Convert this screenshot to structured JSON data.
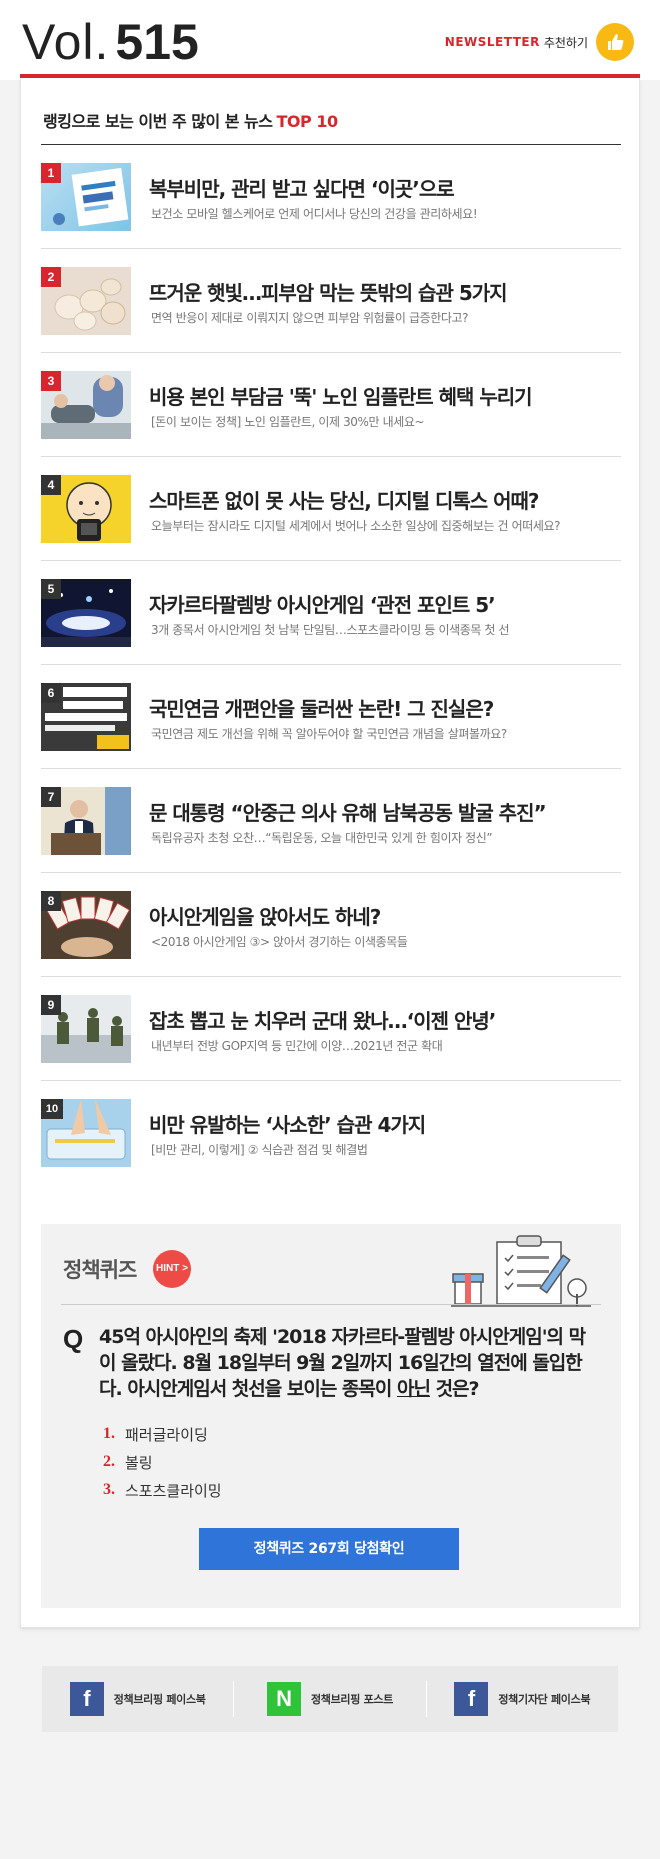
{
  "header": {
    "vol_prefix": "Vol.",
    "vol_number": "515",
    "newsletter_label": "NEWSLETTER",
    "recommend_label": "추천하기"
  },
  "ranking": {
    "title_prefix": "랭킹으로 보는 이번 주 많이 본 뉴스",
    "title_highlight": "TOP 10",
    "items": [
      {
        "rank": "1",
        "title": "복부비만, 관리 받고 싶다면 ‘이곳’으로",
        "subtitle": "보건소 모바일 헬스케어로 언제 어디서나 당신의 건강을 관리하세요!"
      },
      {
        "rank": "2",
        "title": "뜨거운 햇빛…피부암 막는 뜻밖의 습관 5가지",
        "subtitle": "면역 반응이 제대로 이뤄지지 않으면 피부암 위험률이 급증한다고?"
      },
      {
        "rank": "3",
        "title": "비용 본인 부담금 '뚝' 노인 임플란트 혜택 누리기",
        "subtitle": "[돈이 보이는 정책] 노인 임플란트, 이제 30%만 내세요~"
      },
      {
        "rank": "4",
        "title": "스마트폰 없이 못 사는 당신, 디지털 디톡스 어때?",
        "subtitle": "오늘부터는 잠시라도 디지털 세계에서 벗어나 소소한 일상에 집중해보는 건 어떠세요?"
      },
      {
        "rank": "5",
        "title": "자카르타팔렘방 아시안게임 ‘관전 포인트 5’",
        "subtitle": "3개 종목서 아시안게임 첫 남북 단일팀…스포츠클라이밍 등 이색종목 첫 선"
      },
      {
        "rank": "6",
        "title": "국민연금 개편안을 둘러싼 논란! 그 진실은?",
        "subtitle": "국민연금 제도 개선을 위해 꼭 알아두어야 할 국민연금 개념을 살펴볼까요?"
      },
      {
        "rank": "7",
        "title": "문 대통령 “안중근 의사 유해 남북공동 발굴 추진”",
        "subtitle": "독립유공자 초청 오찬…“독립운동, 오늘 대한민국 있게 한 힘이자 정신”"
      },
      {
        "rank": "8",
        "title": "아시안게임을 앉아서도 하네?",
        "subtitle": "<2018 아시안게임 ③> 앉아서 경기하는 이색종목들"
      },
      {
        "rank": "9",
        "title": "잡초 뽑고 눈 치우러 군대 왔나…‘이젠 안녕’",
        "subtitle": "내년부터 전방 GOP지역 등 민간에 이양…2021년 전군 확대"
      },
      {
        "rank": "10",
        "title": "비만 유발하는 ‘사소한’ 습관 4가지",
        "subtitle": "[비만 관리, 이렇게] ② 식습관 점검 및 해결법"
      }
    ]
  },
  "quiz": {
    "title": "정책퀴즈",
    "hint_label": "HINT >",
    "q_mark": "Q",
    "question_before": "45억 아시아인의 축제 '2018 자카르타-팔렘방 아시안게임'의 막이 올랐다. 8월 18일부터 9월 2일까지 16일간의 열전에 돌입한다. 아시안게임서 첫선을 보이는 종목이 ",
    "question_underline": "아닌",
    "question_after": " 것은?",
    "options": [
      {
        "num": "1.",
        "label": "패러글라이딩"
      },
      {
        "num": "2.",
        "label": "볼링"
      },
      {
        "num": "3.",
        "label": "스포츠클라이밍"
      }
    ],
    "button_label": "정책퀴즈 267회 당첨확인"
  },
  "footer": {
    "links": [
      {
        "icon": "facebook-icon",
        "glyph": "f",
        "label": "정책브리핑 페이스북"
      },
      {
        "icon": "naver-post-icon",
        "glyph": "N",
        "label": "정책브리핑 포스트"
      },
      {
        "icon": "facebook-icon",
        "glyph": "f",
        "label": "정책기자단 페이스북"
      }
    ]
  },
  "colors": {
    "accent": "#d8262e",
    "button": "#2f74d8",
    "facebook": "#3c5898",
    "naver": "#2fc33a"
  }
}
